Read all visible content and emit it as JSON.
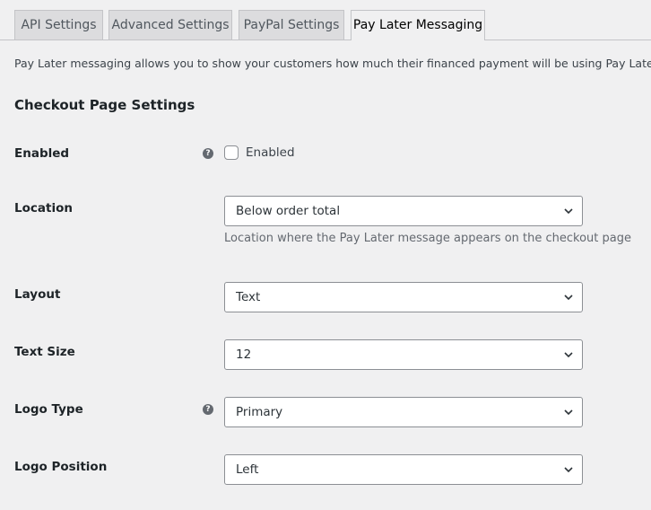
{
  "tabs": [
    {
      "label": "API Settings",
      "active": false
    },
    {
      "label": "Advanced Settings",
      "active": false
    },
    {
      "label": "PayPal Settings",
      "active": false
    },
    {
      "label": "Pay Later Messaging",
      "active": true
    }
  ],
  "intro": "Pay Later messaging allows you to show your customers how much their financed payment will be using Pay Later.",
  "section_title": "Checkout Page Settings",
  "help_glyph": "?",
  "fields": {
    "enabled": {
      "label": "Enabled",
      "checkbox_label": "Enabled",
      "checked": false
    },
    "location": {
      "label": "Location",
      "value": "Below order total",
      "description": "Location where the Pay Later message appears on the checkout page"
    },
    "layout": {
      "label": "Layout",
      "value": "Text"
    },
    "text_size": {
      "label": "Text Size",
      "value": "12"
    },
    "logo_type": {
      "label": "Logo Type",
      "value": "Primary"
    },
    "logo_position": {
      "label": "Logo Position",
      "value": "Left"
    }
  },
  "colors": {
    "background": "#f0f0f1",
    "tab_inactive": "#dcdcde",
    "border": "#8c8f94",
    "help_icon": "#646970"
  }
}
